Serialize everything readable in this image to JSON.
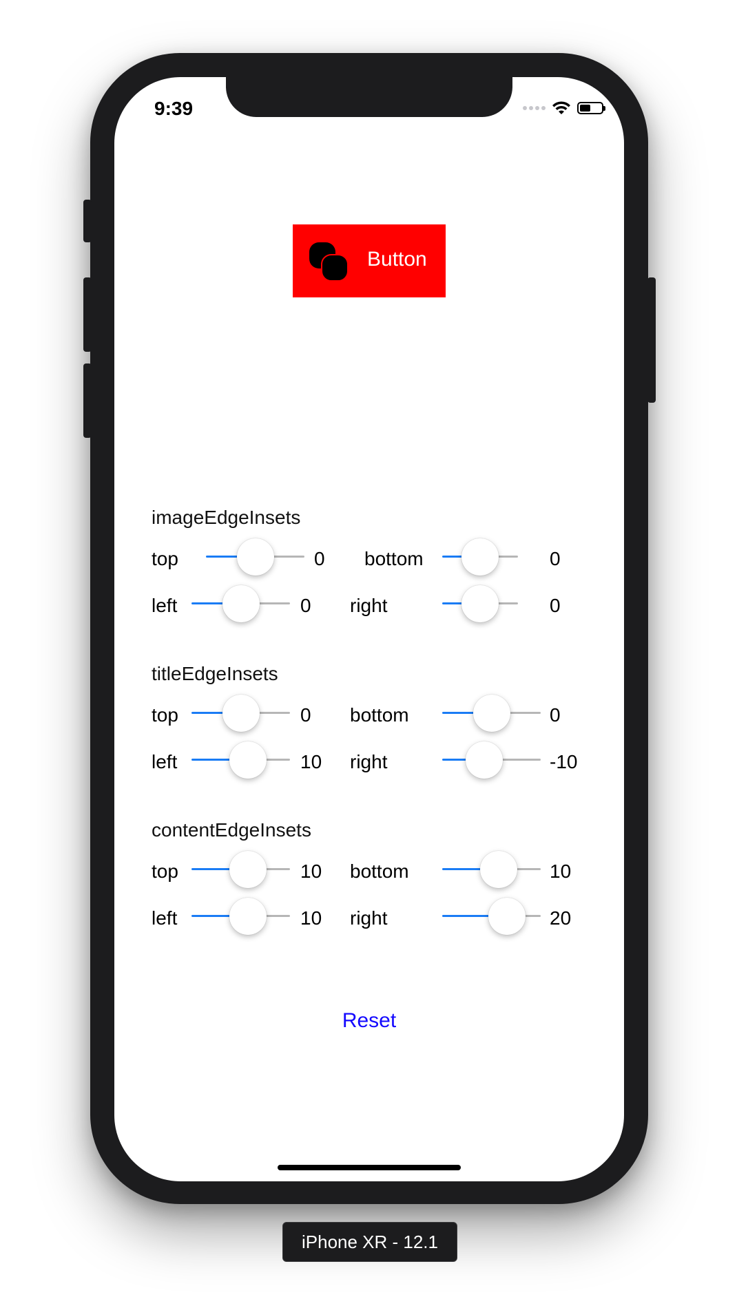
{
  "status_bar": {
    "time": "9:39"
  },
  "demo_button": {
    "label": "Button"
  },
  "sections": [
    {
      "title": "imageEdgeInsets",
      "controls": [
        {
          "label": "top",
          "value": "0",
          "level": 0.5
        },
        {
          "label": "bottom",
          "value": "0",
          "level": 0.5
        },
        {
          "label": "left",
          "value": "0",
          "level": 0.5
        },
        {
          "label": "right",
          "value": "0",
          "level": 0.5
        }
      ]
    },
    {
      "title": "titleEdgeInsets",
      "controls": [
        {
          "label": "top",
          "value": "0",
          "level": 0.5
        },
        {
          "label": "bottom",
          "value": "0",
          "level": 0.5
        },
        {
          "label": "left",
          "value": "10",
          "level": 0.62
        },
        {
          "label": "right",
          "value": "-10",
          "level": 0.38
        }
      ]
    },
    {
      "title": "contentEdgeInsets",
      "controls": [
        {
          "label": "top",
          "value": "10",
          "level": 0.62
        },
        {
          "label": "bottom",
          "value": "10",
          "level": 0.62
        },
        {
          "label": "left",
          "value": "10",
          "level": 0.62
        },
        {
          "label": "right",
          "value": "20",
          "level": 0.75
        }
      ]
    }
  ],
  "reset_label": "Reset",
  "device_label": "iPhone XR - 12.1",
  "colors": {
    "button_bg": "#ff0000",
    "slider_min_track": "#1a7cf5",
    "slider_max_track": "#b6b6b6",
    "reset_link": "#1409ff"
  }
}
